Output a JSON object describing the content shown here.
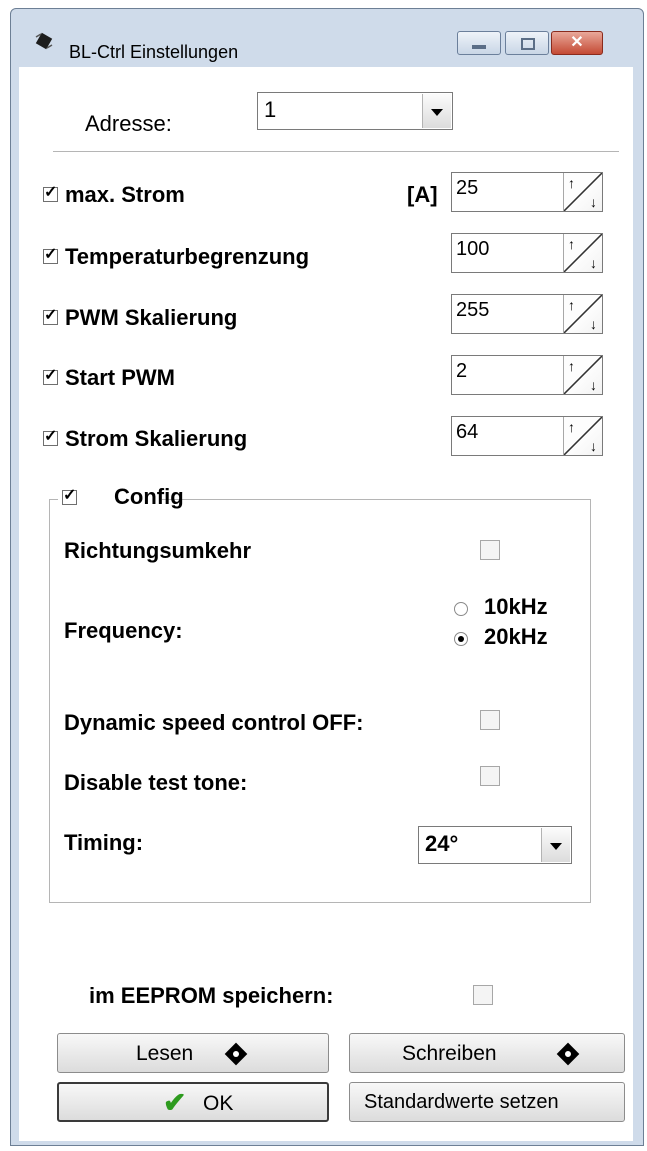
{
  "window": {
    "title": "BL-Ctrl Einstellungen",
    "close_glyph": "✕"
  },
  "address": {
    "label": "Adresse:",
    "value": "1"
  },
  "settings": [
    {
      "label": "max. Strom",
      "unit": "[A]",
      "value": "25",
      "checked": true
    },
    {
      "label": "Temperaturbegrenzung",
      "value": "100",
      "checked": true
    },
    {
      "label": "PWM Skalierung",
      "value": "255",
      "checked": true
    },
    {
      "label": "Start PWM",
      "value": "2",
      "checked": true
    },
    {
      "label": "Strom Skalierung",
      "value": "64",
      "checked": true
    }
  ],
  "config": {
    "label": "Config",
    "checked": true,
    "richtung_label": "Richtungsumkehr",
    "frequency_label": "Frequency:",
    "freq_options": [
      "10kHz",
      "20kHz"
    ],
    "freq_selected": "20kHz",
    "dynamic_label": "Dynamic speed control OFF:",
    "test_tone_label": "Disable test tone:",
    "timing_label": "Timing:",
    "timing_value": "24°"
  },
  "eeprom_label": "im EEPROM speichern:",
  "buttons": {
    "lesen": "Lesen",
    "schreiben": "Schreiben",
    "ok": "OK",
    "defaults": "Standardwerte setzen"
  },
  "icons": [
    "chip-icon",
    "minimize-icon",
    "maximize-icon",
    "close-icon",
    "read-chip-icon",
    "write-chip-icon",
    "checkmark-icon"
  ]
}
